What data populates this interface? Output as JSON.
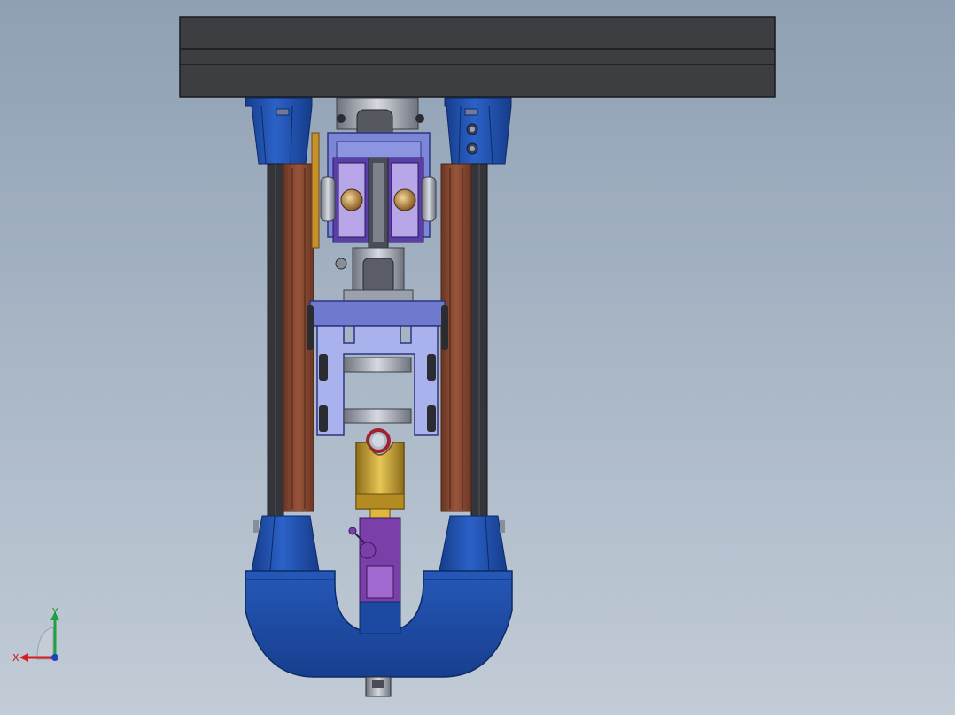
{
  "viewport": {
    "background_top": "#8fa0b4",
    "background_bottom": "#c2ccd7"
  },
  "colors": {
    "plate": "#3d3e42",
    "plate_edge": "#1a1a1c",
    "blue_part": "#1f4fa8",
    "blue_dark": "#12337a",
    "rail_dark": "#2f2f33",
    "wood": "#8a4a32",
    "wood_dark": "#5d2f1f",
    "lavender": "#7c86d6",
    "lavender_light": "#aab2ee",
    "purple_profile": "#5b3fa6",
    "steel": "#b5b9c4",
    "steel_dark": "#5d6068",
    "brass": "#c9a23a",
    "brass_dark": "#8b6d1a",
    "violet": "#7a3fa8",
    "red_ring": "#a02030",
    "x_axis": "#d42020",
    "y_axis": "#20a040",
    "z_axis": "#2040c0"
  },
  "triad": {
    "x_label": "X",
    "y_label": "Y",
    "x_icon": "x-axis-arrow-icon",
    "y_icon": "y-axis-arrow-icon"
  }
}
